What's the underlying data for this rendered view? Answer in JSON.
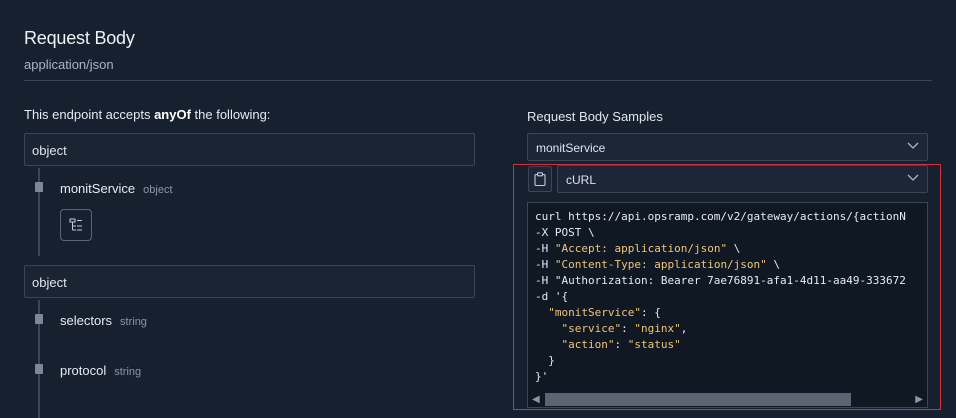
{
  "header": {
    "title": "Request Body",
    "subtitle": "application/json"
  },
  "left": {
    "accepts_prefix": "This endpoint accepts ",
    "accepts_keyword": "anyOf",
    "accepts_suffix": " the following:",
    "schemas": [
      {
        "label": "object",
        "properties": [
          {
            "name": "monitService",
            "type": "object"
          }
        ]
      },
      {
        "label": "object",
        "properties": [
          {
            "name": "selectors",
            "type": "string"
          },
          {
            "name": "protocol",
            "type": "string"
          }
        ]
      }
    ]
  },
  "right": {
    "label": "Request Body Samples",
    "sample_select": "monitService",
    "language_select": "cURL",
    "code_lines": [
      "curl https://api.opsramp.com/v2/gateway/actions/{actionN",
      "-X POST \\",
      "-H \"Accept: application/json\" \\",
      "-H \"Content-Type: application/json\" \\",
      "-H \"Authorization: Bearer 7ae76891-afa1-4d11-aa49-333672",
      "-d '{",
      "  \"monitService\": {",
      "    \"service\": \"nginx\",",
      "    \"action\": \"status\"",
      "  }",
      "}'"
    ]
  },
  "icons": {
    "expand": "tree-expand-icon",
    "clipboard": "clipboard-icon",
    "chevron": "chevron-down-icon"
  },
  "colors": {
    "highlight": "#d0303a",
    "string": "#f2c47a",
    "background": "#16202f"
  }
}
